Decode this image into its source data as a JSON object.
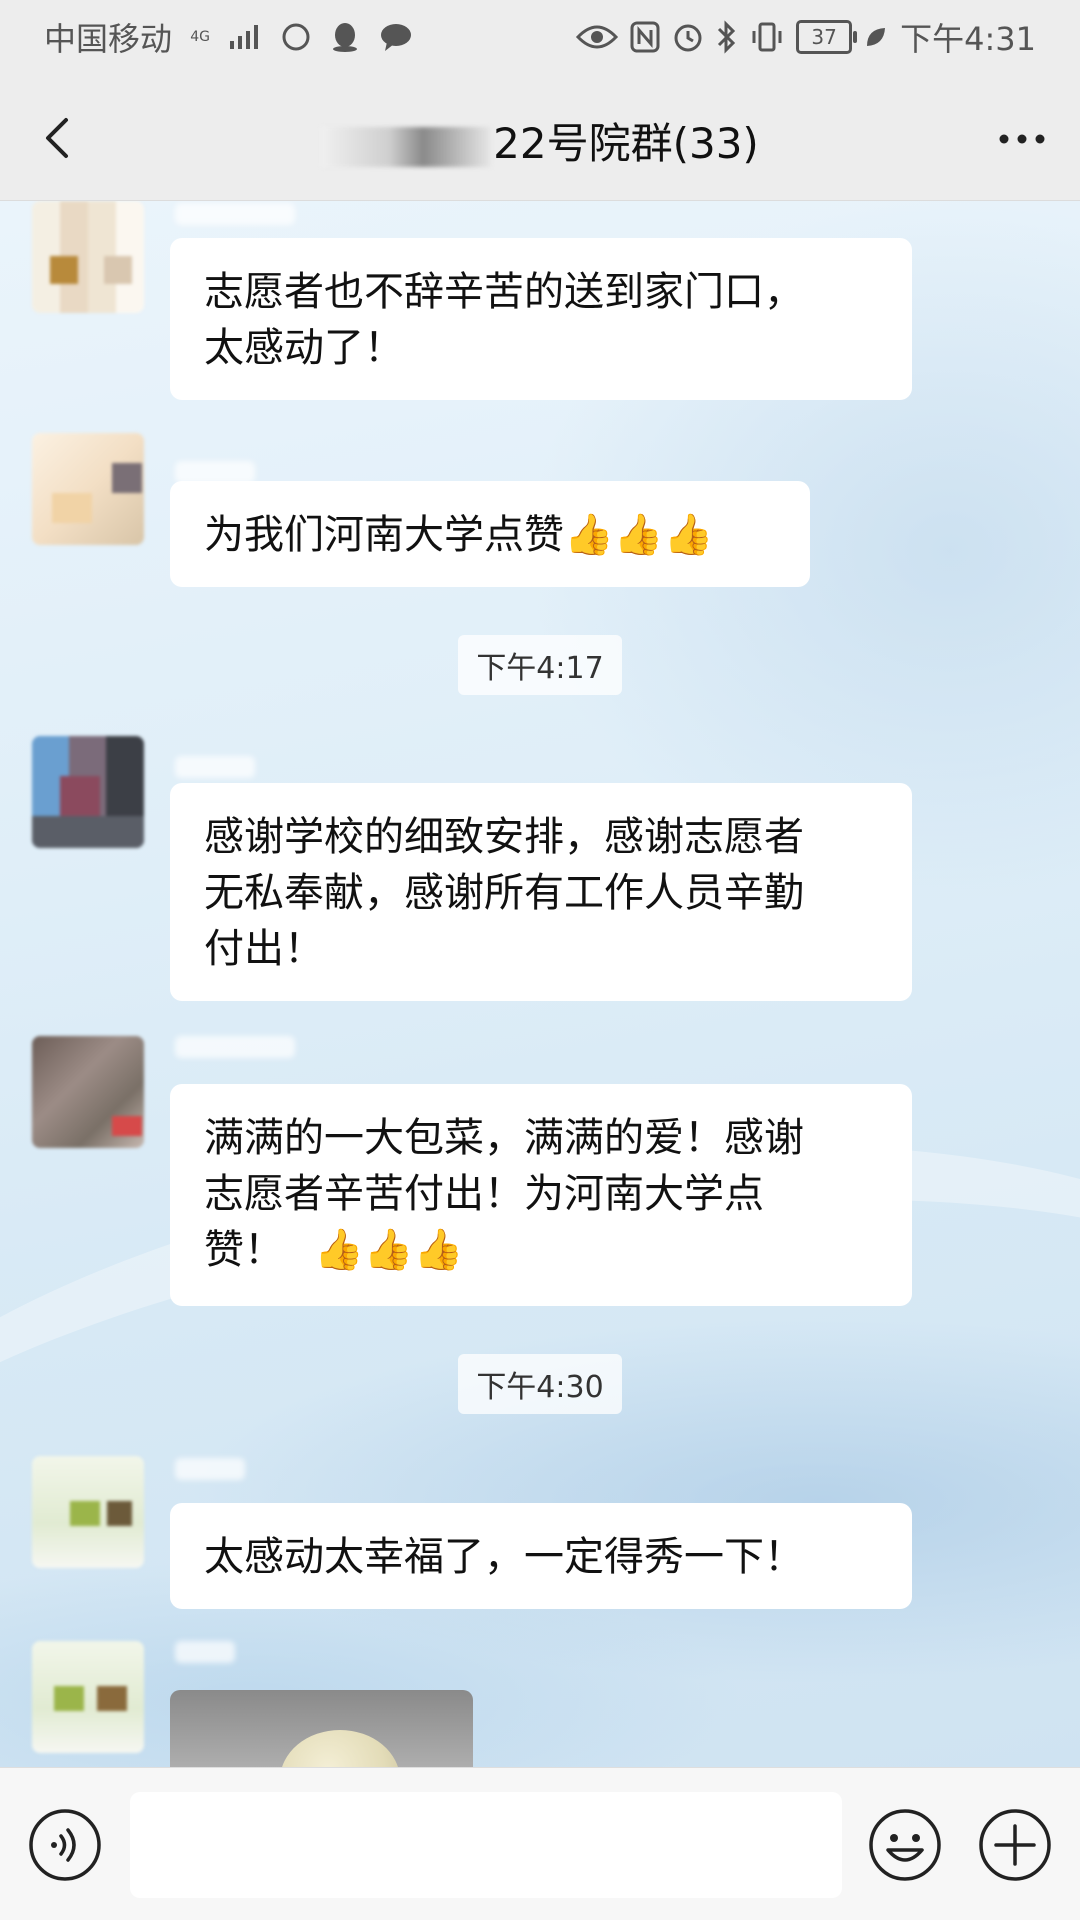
{
  "status_bar": {
    "carrier": "中国移动",
    "network": "4G",
    "battery": "37",
    "time": "下午4:31"
  },
  "nav": {
    "title": "22号院群(33)",
    "back_icon": "chevron-left-icon",
    "more_icon": "more-dots-icon"
  },
  "messages": [
    {
      "text": "志愿者也不辞辛苦的送到家门口，\n太感动了！",
      "thumbs": ""
    },
    {
      "text": "为我们河南大学点赞",
      "thumbs": "👍👍👍"
    },
    {
      "text": "感谢学校的细致安排，感谢志愿者\n无私奉献，感谢所有工作人员辛勤\n付出！",
      "thumbs": ""
    },
    {
      "text": "满满的一大包菜，满满的爱！感谢\n志愿者辛苦付出！为河南大学点\n赞！",
      "thumbs": "👍👍👍"
    },
    {
      "text": "太感动太幸福了，一定得秀一下！",
      "thumbs": ""
    }
  ],
  "timestamps": [
    "下午4:17",
    "下午4:30"
  ],
  "input": {
    "placeholder": "",
    "value": ""
  },
  "colors": {
    "accent": "#07c160",
    "bubble": "#ffffff"
  }
}
